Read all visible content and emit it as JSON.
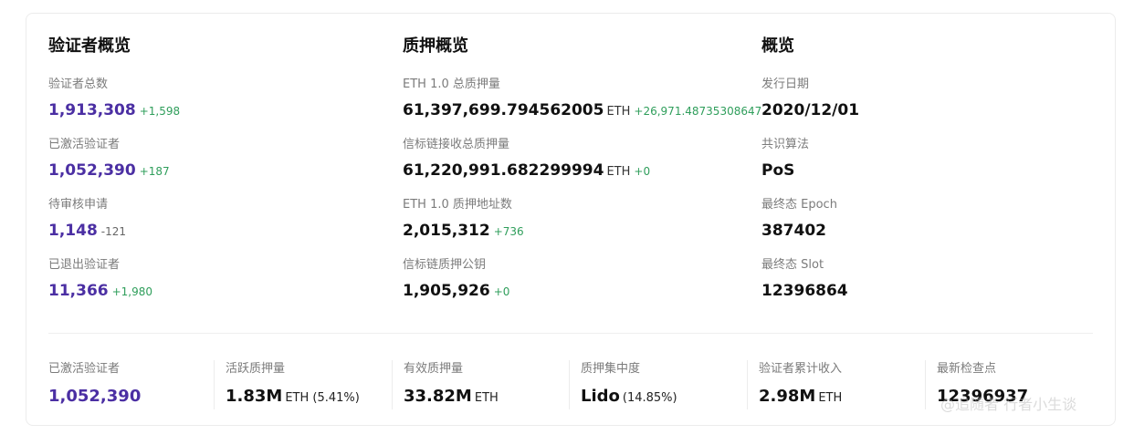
{
  "validator_overview": {
    "title": "验证者概览",
    "items": [
      {
        "label": "验证者总数",
        "value": "1,913,308",
        "delta": "+1,598",
        "delta_sign": "pos"
      },
      {
        "label": "已激活验证者",
        "value": "1,052,390",
        "delta": "+187",
        "delta_sign": "pos"
      },
      {
        "label": "待审核申请",
        "value": "1,148",
        "delta": "-121",
        "delta_sign": "neg"
      },
      {
        "label": "已退出验证者",
        "value": "11,366",
        "delta": "+1,980",
        "delta_sign": "pos"
      }
    ]
  },
  "staking_overview": {
    "title": "质押概览",
    "items": [
      {
        "label": "ETH 1.0 总质押量",
        "value": "61,397,699.794562005",
        "unit": "ETH",
        "delta": "+26,971.48735308647"
      },
      {
        "label": "信标链接收总质押量",
        "value": "61,220,991.682299994",
        "unit": "ETH",
        "delta": "+0"
      },
      {
        "label": "ETH 1.0 质押地址数",
        "value": "2,015,312",
        "unit": "",
        "delta": "+736"
      },
      {
        "label": "信标链质押公钥",
        "value": "1,905,926",
        "unit": "",
        "delta": "+0"
      }
    ]
  },
  "overview": {
    "title": "概览",
    "items": [
      {
        "label": "发行日期",
        "value": "2020/12/01"
      },
      {
        "label": "共识算法",
        "value": "PoS"
      },
      {
        "label": "最终态 Epoch",
        "value": "387402"
      },
      {
        "label": "最终态 Slot",
        "value": "12396864"
      }
    ]
  },
  "summary": [
    {
      "label": "已激活验证者",
      "value": "1,052,390",
      "suffix": ""
    },
    {
      "label": "活跃质押量",
      "value": "1.83M",
      "suffix": "ETH (5.41%)"
    },
    {
      "label": "有效质押量",
      "value": "33.82M",
      "suffix": "ETH"
    },
    {
      "label": "质押集中度",
      "value": "Lido",
      "suffix": "(14.85%)"
    },
    {
      "label": "验证者累计收入",
      "value": "2.98M",
      "suffix": "ETH"
    },
    {
      "label": "最新检查点",
      "value": "12396937",
      "suffix": ""
    }
  ],
  "watermark": "@追随者 行者小生谈"
}
